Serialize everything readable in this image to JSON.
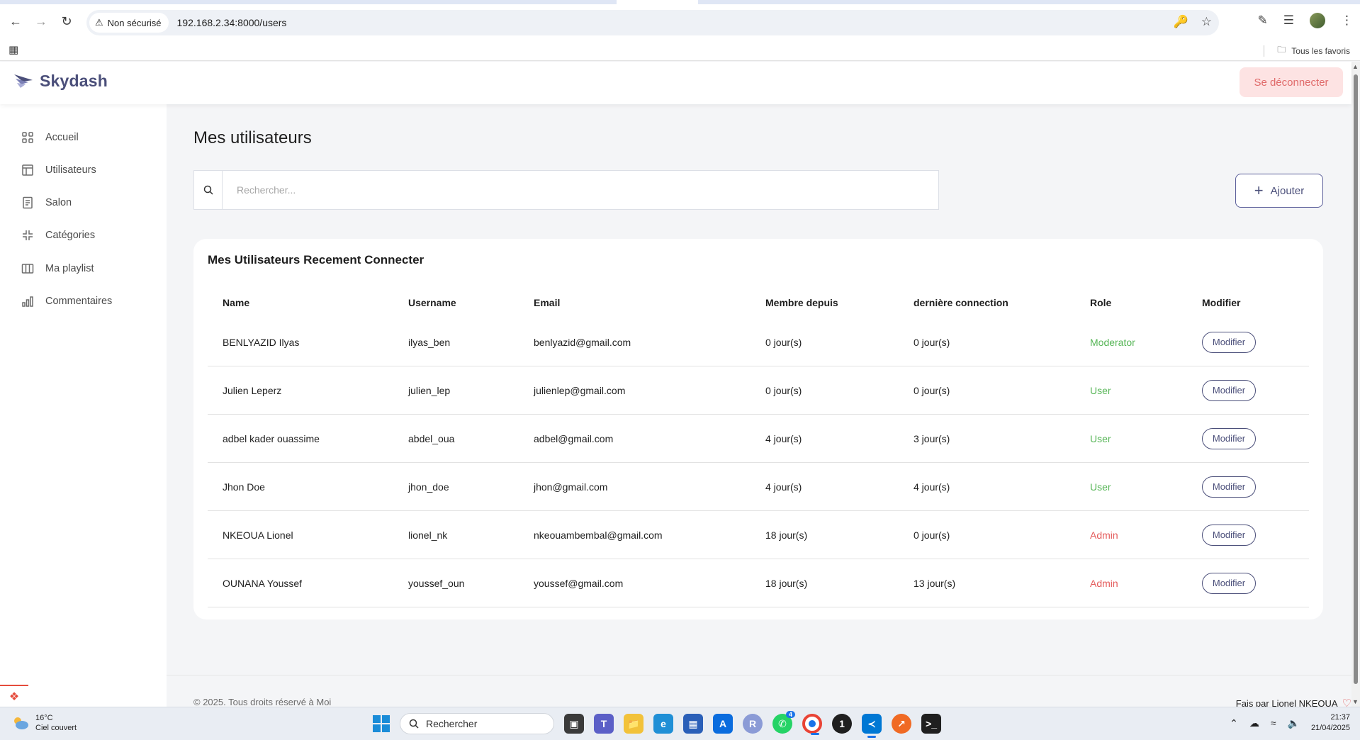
{
  "browser": {
    "security_label": "Non sécurisé",
    "url": "192.168.2.34:8000/users",
    "bookmarks_label": "Tous les favoris"
  },
  "header": {
    "brand": "Skydash",
    "logout_label": "Se déconnecter"
  },
  "sidebar": {
    "items": [
      {
        "label": "Accueil",
        "icon": "grid-icon"
      },
      {
        "label": "Utilisateurs",
        "icon": "layout-icon"
      },
      {
        "label": "Salon",
        "icon": "document-icon"
      },
      {
        "label": "Catégories",
        "icon": "collapse-icon"
      },
      {
        "label": "Ma playlist",
        "icon": "columns-icon"
      },
      {
        "label": "Commentaires",
        "icon": "bar-chart-icon"
      }
    ]
  },
  "main": {
    "title": "Mes utilisateurs",
    "search_placeholder": "Rechercher...",
    "add_label": "Ajouter",
    "card_title": "Mes Utilisateurs Recement Connecter",
    "columns": [
      "Name",
      "Username",
      "Email",
      "Membre depuis",
      "dernière connection",
      "Role",
      "Modifier"
    ],
    "rows": [
      {
        "name": "BENLYAZID Ilyas",
        "username": "ilyas_ben",
        "email": "benlyazid@gmail.com",
        "membre": "0 jour(s)",
        "derniere": "0 jour(s)",
        "role": "Moderator",
        "action": "Modifier"
      },
      {
        "name": "Julien Leperz",
        "username": "julien_lep",
        "email": "julienlep@gmail.com",
        "membre": "0 jour(s)",
        "derniere": "0 jour(s)",
        "role": "User",
        "action": "Modifier"
      },
      {
        "name": "adbel kader ouassime",
        "username": "abdel_oua",
        "email": "adbel@gmail.com",
        "membre": "4 jour(s)",
        "derniere": "3 jour(s)",
        "role": "User",
        "action": "Modifier"
      },
      {
        "name": "Jhon Doe",
        "username": "jhon_doe",
        "email": "jhon@gmail.com",
        "membre": "4 jour(s)",
        "derniere": "4 jour(s)",
        "role": "User",
        "action": "Modifier"
      },
      {
        "name": "NKEOUA Lionel",
        "username": "lionel_nk",
        "email": "nkeouambembal@gmail.com",
        "membre": "18 jour(s)",
        "derniere": "0 jour(s)",
        "role": "Admin",
        "action": "Modifier"
      },
      {
        "name": "OUNANA Youssef",
        "username": "youssef_oun",
        "email": "youssef@gmail.com",
        "membre": "18 jour(s)",
        "derniere": "13 jour(s)",
        "role": "Admin",
        "action": "Modifier"
      }
    ]
  },
  "footer": {
    "copyright": "© 2025. Tous droits réservé à Moi",
    "credit": "Fais par Lionel NKEOUA"
  },
  "taskbar": {
    "temperature": "16°C",
    "weather": "Ciel couvert",
    "search_label": "Rechercher",
    "whatsapp_badge": "4",
    "time": "21:37",
    "date": "21/04/2025"
  },
  "colors": {
    "brand": "#4b4f7a",
    "role_moderator": "#57b657",
    "role_user": "#57b657",
    "role_admin": "#e45b5b",
    "logout_bg": "#fde3e3",
    "logout_text": "#e06a6a"
  }
}
